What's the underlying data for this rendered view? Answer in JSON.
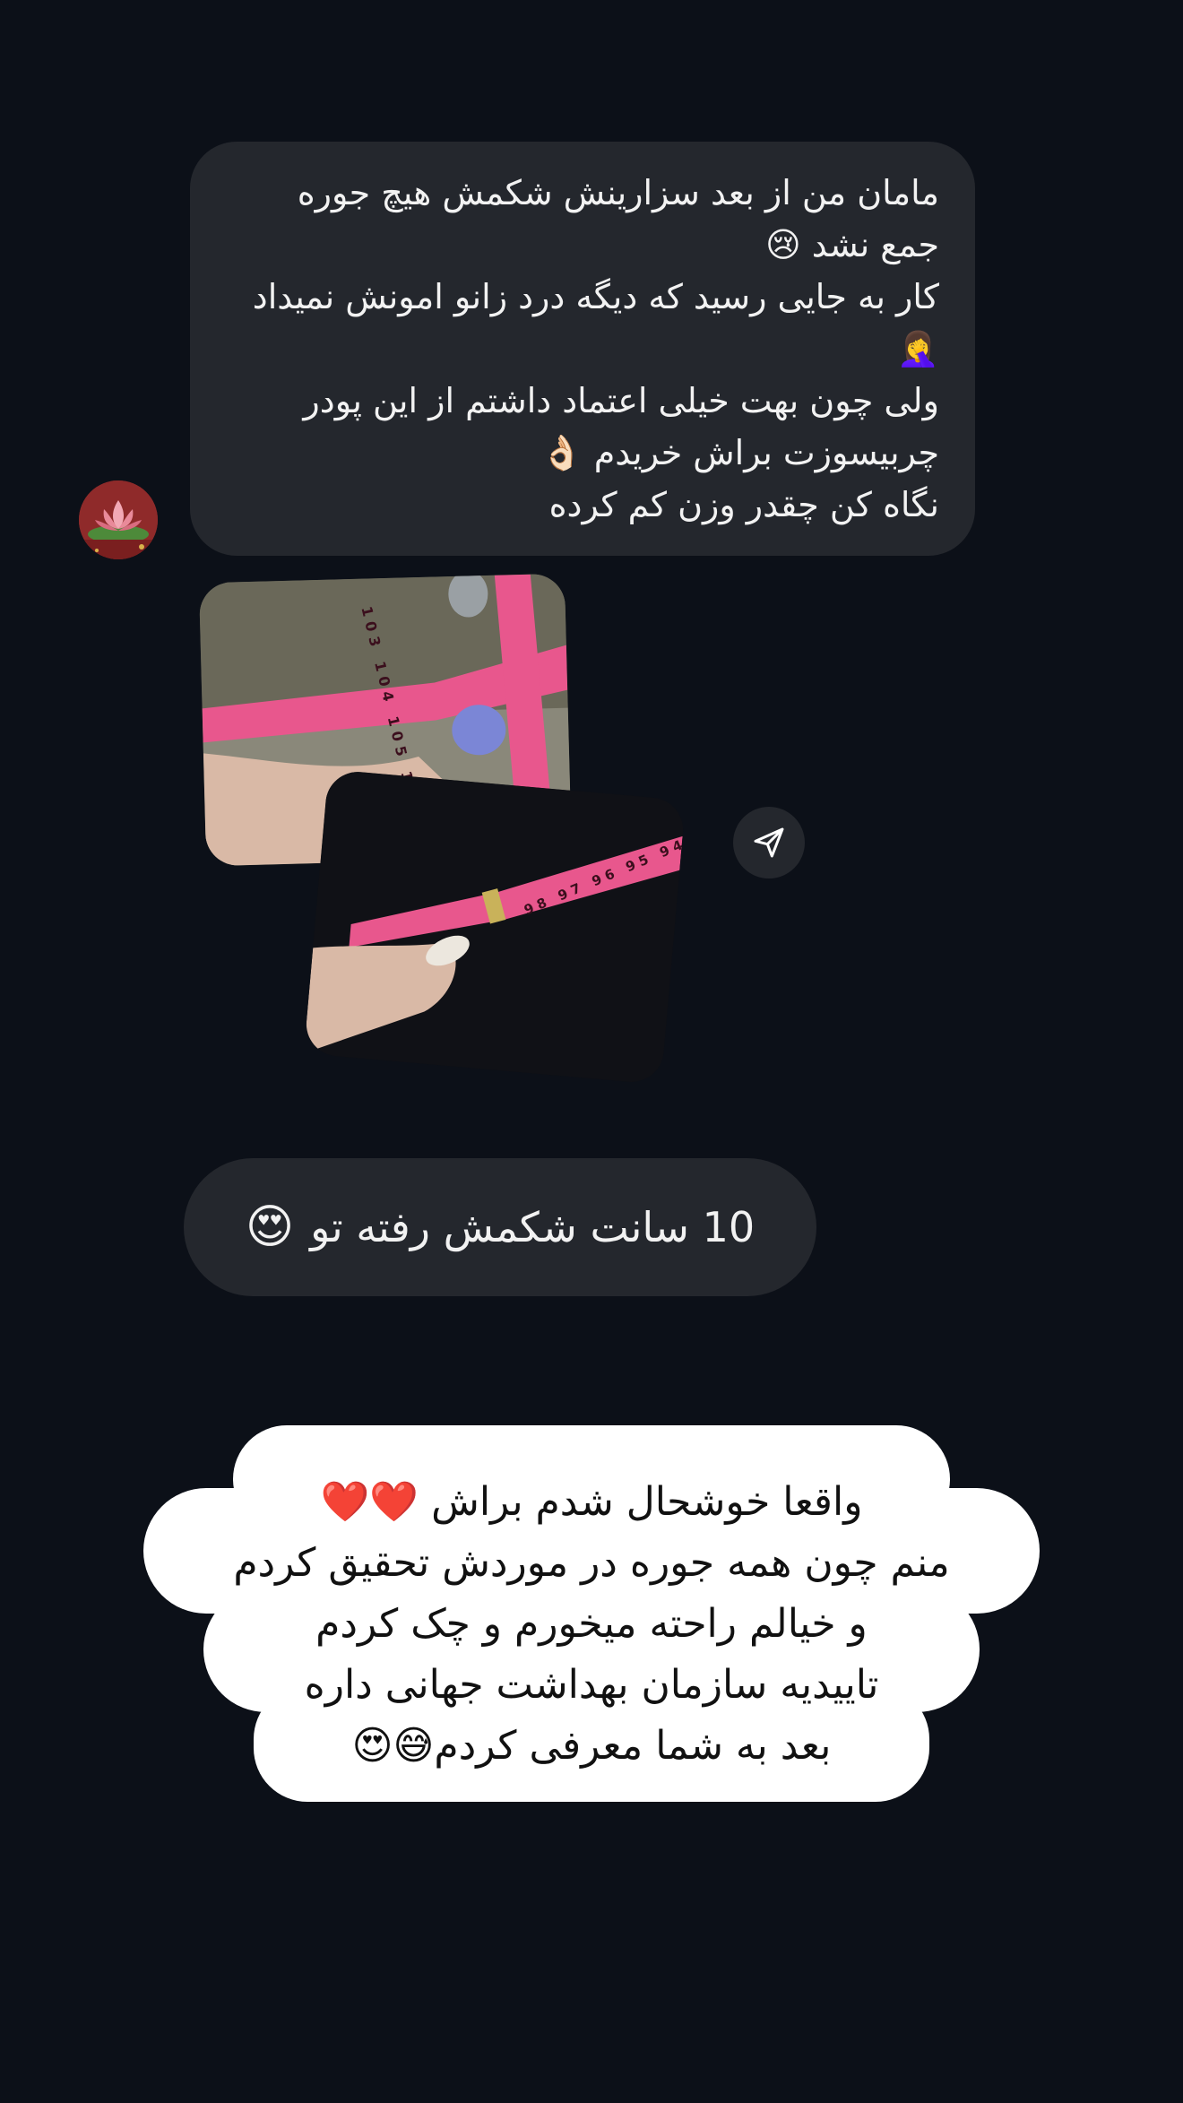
{
  "conversation": {
    "incoming_message": {
      "lines": [
        "مامان من از بعد سزارینش شکمش هیچ جوره",
        "جمع نشد 😢",
        "کار به جایی رسید که دیگه درد زانو امونش نمیداد",
        "🤦‍♀️",
        "ولی چون بهت خیلی اعتماد داشتم از این پودر",
        "چربیسوزت براش خریدم 👌🏻",
        "نگاه کن چقدر وزن کم کرده"
      ]
    },
    "photos": {
      "first_tape_numbers": "103 104 105 106 108",
      "second_tape_numbers": "98 97 96 95 94"
    },
    "follow_up_message": {
      "text": "10 سانت شکمش رفته تو",
      "emoji": "😍"
    },
    "reply_sticker": {
      "lines": [
        "واقعا خوشحال شدم براش ❤️❤️",
        "منم چون همه جوره در موردش تحقیق کردم",
        "و خیالم راحته میخورم و چک کردم",
        "تاییدیه سازمان بهداشت جهانی داره",
        "بعد به شما معرفی کردم😅😍"
      ]
    }
  },
  "icons": {
    "share": "paper-plane-icon",
    "avatar": "lotus-avatar"
  },
  "colors": {
    "background": "#0c1018",
    "bubble": "#24272d",
    "sticker": "#ffffff",
    "tape": "#e8578d"
  }
}
